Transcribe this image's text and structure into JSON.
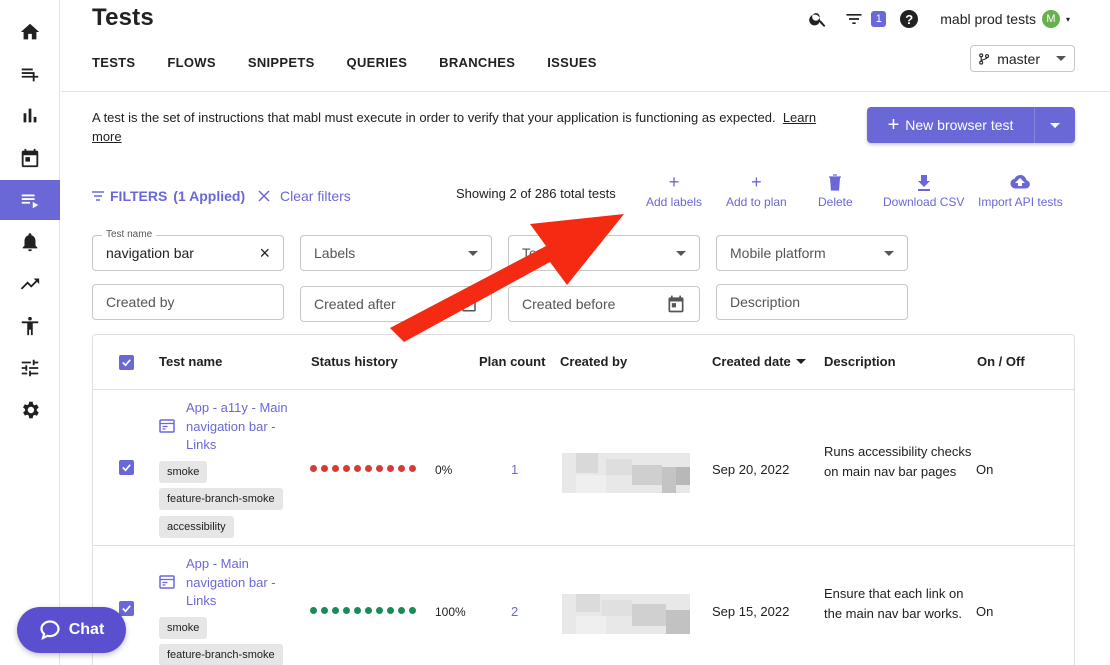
{
  "rail": {
    "items": [
      {
        "icon": "home-icon"
      },
      {
        "icon": "playlist-add-icon"
      },
      {
        "icon": "bar-chart-icon"
      },
      {
        "icon": "calendar-icon"
      },
      {
        "icon": "tests-list-icon",
        "active": true
      },
      {
        "icon": "bell-icon"
      },
      {
        "icon": "trending-up-icon"
      },
      {
        "icon": "accessibility-icon"
      },
      {
        "icon": "sliders-icon"
      },
      {
        "icon": "settings-gear-icon"
      }
    ]
  },
  "header": {
    "title": "Tests",
    "filter_badge": "1",
    "workspace": "mabl prod tests",
    "avatar_letter": "M",
    "branch": "master"
  },
  "tabs": [
    "TESTS",
    "FLOWS",
    "SNIPPETS",
    "QUERIES",
    "BRANCHES",
    "ISSUES"
  ],
  "intro": {
    "text": "A test is the set of instructions that mabl must execute in order to verify that your application is functioning as expected.",
    "link_learn": "Learn",
    "link_more": "more"
  },
  "new_button": {
    "label": "New browser test"
  },
  "filter_bar": {
    "filters_label": "FILTERS",
    "applied": "(1 Applied)",
    "clear_label": "Clear filters",
    "showing": "Showing 2 of 286 total tests"
  },
  "actions": {
    "add_labels": "Add labels",
    "add_to_plan": "Add to plan",
    "delete": "Delete",
    "download_csv": "Download CSV",
    "import_api": "Import API tests"
  },
  "fields": {
    "test_name_legend": "Test name",
    "test_name_value": "navigation bar",
    "labels": "Labels",
    "test_type": "Test type",
    "mobile_platform": "Mobile platform",
    "created_by": "Created by",
    "created_after": "Created after",
    "created_before": "Created before",
    "description": "Description"
  },
  "table": {
    "columns": {
      "name": "Test name",
      "status": "Status history",
      "plan": "Plan count",
      "created_by": "Created by",
      "created_date": "Created date",
      "description": "Description",
      "onoff": "On / Off"
    },
    "rows": [
      {
        "name_line1": "App - a11y - Main",
        "name_line2": "navigation bar -",
        "name_line3": "Links",
        "tags": [
          "smoke",
          "feature-branch-smoke",
          "accessibility"
        ],
        "status_color": "#d63c34",
        "pct": "0%",
        "plan_count": "1",
        "created_date": "Sep 20, 2022",
        "description": "Runs accessibility checks on main nav bar pages",
        "onoff": "On"
      },
      {
        "name_line1": "App - Main",
        "name_line2": "navigation bar -",
        "name_line3": "Links",
        "tags": [
          "smoke",
          "feature-branch-smoke"
        ],
        "status_color": "#1a8a56",
        "pct": "100%",
        "plan_count": "2",
        "created_date": "Sep 15, 2022",
        "description": "Ensure that each link on the main nav bar works.",
        "onoff": "On"
      }
    ]
  },
  "chat": {
    "label": "Chat"
  },
  "colors": {
    "accent": "#6a68d6",
    "arrow": "#f52a12"
  }
}
